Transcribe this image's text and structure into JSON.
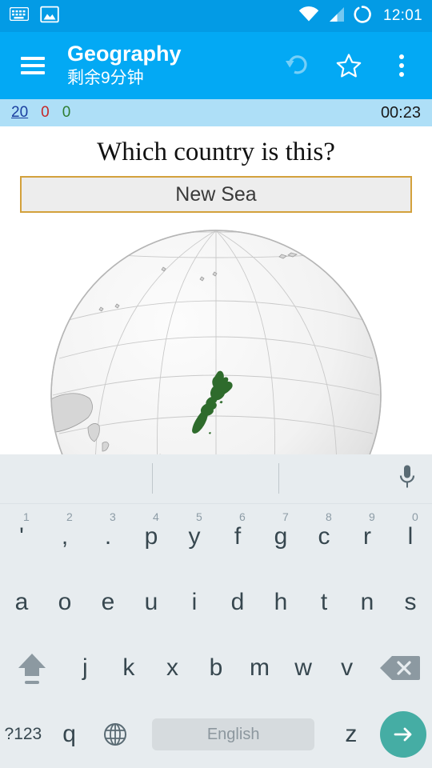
{
  "status_bar": {
    "time": "12:01",
    "icons_left": [
      "keyboard-icon",
      "image-icon"
    ],
    "icons_right": [
      "wifi-icon",
      "signal-icon",
      "sync-circle-icon"
    ],
    "background_color": "#039BE5"
  },
  "app_bar": {
    "menu_icon": "hamburger-icon",
    "title": "Geography",
    "subtitle": "剩余9分钟",
    "actions": [
      "undo-icon",
      "star-icon",
      "overflow-menu-icon"
    ],
    "background_color": "#03A9F4"
  },
  "score_bar": {
    "total": "20",
    "wrong": "0",
    "correct": "0",
    "timer": "00:23",
    "total_color": "#1A3FA0",
    "wrong_color": "#C62828",
    "correct_color": "#2E7D32",
    "background_color": "#AEDFF7"
  },
  "quiz": {
    "question": "Which country is this?",
    "answer_value": "New Sea",
    "answer_placeholder": "",
    "answer_border_color": "#D3A13C",
    "answer_fill_color": "#EDEDED"
  },
  "globe": {
    "description": "orthographic-globe-oceania",
    "highlight_color": "#2E6B2C",
    "land_color": "#D5D5D5",
    "ocean_color": "#F4F4F4"
  },
  "keyboard": {
    "layout": "dvorak",
    "suggestion_bar": {
      "suggestions": [
        "",
        "",
        ""
      ],
      "mic_icon": "microphone-icon"
    },
    "row1": [
      {
        "label": "'",
        "hint": "1"
      },
      {
        "label": ",",
        "hint": "2"
      },
      {
        "label": ".",
        "hint": "3"
      },
      {
        "label": "p",
        "hint": "4"
      },
      {
        "label": "y",
        "hint": "5"
      },
      {
        "label": "f",
        "hint": "6"
      },
      {
        "label": "g",
        "hint": "7"
      },
      {
        "label": "c",
        "hint": "8"
      },
      {
        "label": "r",
        "hint": "9"
      },
      {
        "label": "l",
        "hint": "0"
      }
    ],
    "row2": [
      {
        "label": "a"
      },
      {
        "label": "o"
      },
      {
        "label": "e"
      },
      {
        "label": "u"
      },
      {
        "label": "i"
      },
      {
        "label": "d"
      },
      {
        "label": "h"
      },
      {
        "label": "t"
      },
      {
        "label": "n"
      },
      {
        "label": "s"
      }
    ],
    "row3": [
      {
        "label": "j"
      },
      {
        "label": "k"
      },
      {
        "label": "x"
      },
      {
        "label": "b"
      },
      {
        "label": "m"
      },
      {
        "label": "w"
      },
      {
        "label": "v"
      }
    ],
    "shift_icon": "shift-icon",
    "backspace_icon": "backspace-icon",
    "row4": {
      "symbols_label": "?123",
      "q_label": "q",
      "globe_icon": "language-globe-icon",
      "space_label": "English",
      "z_label": "z",
      "enter_icon": "arrow-right-icon",
      "enter_color": "#45ADA4"
    },
    "background_color": "#E7ECEF"
  }
}
